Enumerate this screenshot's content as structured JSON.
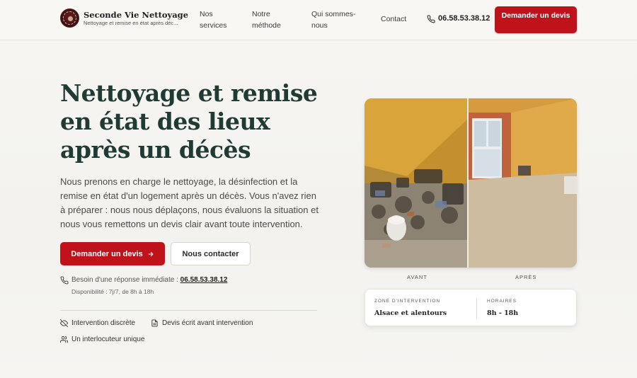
{
  "header": {
    "brand_name": "Seconde Vie Nettoyage",
    "brand_tagline": "Nettoyage et remise en état après déc...",
    "logo_text": "SECONDE VIE",
    "nav": [
      {
        "label": "Nos services",
        "icon": ""
      },
      {
        "label": "Notre méthode",
        "icon": ""
      },
      {
        "label": "Qui sommes-nous",
        "icon": ""
      },
      {
        "label": "Contact",
        "icon": ""
      }
    ],
    "phone": "06.58.53.38.12",
    "phone_icon": "phone-icon",
    "cta_label": "Demander un devis"
  },
  "hero": {
    "title_lines": [
      "Nettoyage et remise",
      "en état des lieux",
      "après un décès"
    ],
    "description": "Nous prenons en charge le nettoyage, la désinfection et la remise en état d'un logement après un décès. Vous n'avez rien à préparer : nous nous déplaçons, nous évaluons la situation et nous vous remettons un devis clair avant toute intervention.",
    "primary_cta": "Demander un devis",
    "primary_cta_icon": "arrow-right-icon",
    "secondary_cta": "Nous contacter",
    "contact_prefix": "Besoin d'une réponse immédiate : ",
    "contact_phone": "06.58.53.38.12",
    "availability": "Disponibilité : 7j/7, de 8h à 18h",
    "features": [
      {
        "label": "Intervention discrète",
        "icon": "eye-off-icon"
      },
      {
        "label": "Devis écrit avant intervention",
        "icon": "document-icon"
      },
      {
        "label": "Un interlocuteur unique",
        "icon": "users-icon"
      }
    ]
  },
  "gallery": {
    "before_caption": "AVANT",
    "after_caption": "APRÈS"
  },
  "info_card": {
    "zone_label": "ZONE D'INTERVENTION",
    "zone_value": "Alsace et alentours",
    "hours_label": "HORAIRES",
    "hours_value": "8h - 18h"
  },
  "colors": {
    "accent": "#c0121a",
    "title": "#203a34",
    "background": "#f5f4f0"
  }
}
